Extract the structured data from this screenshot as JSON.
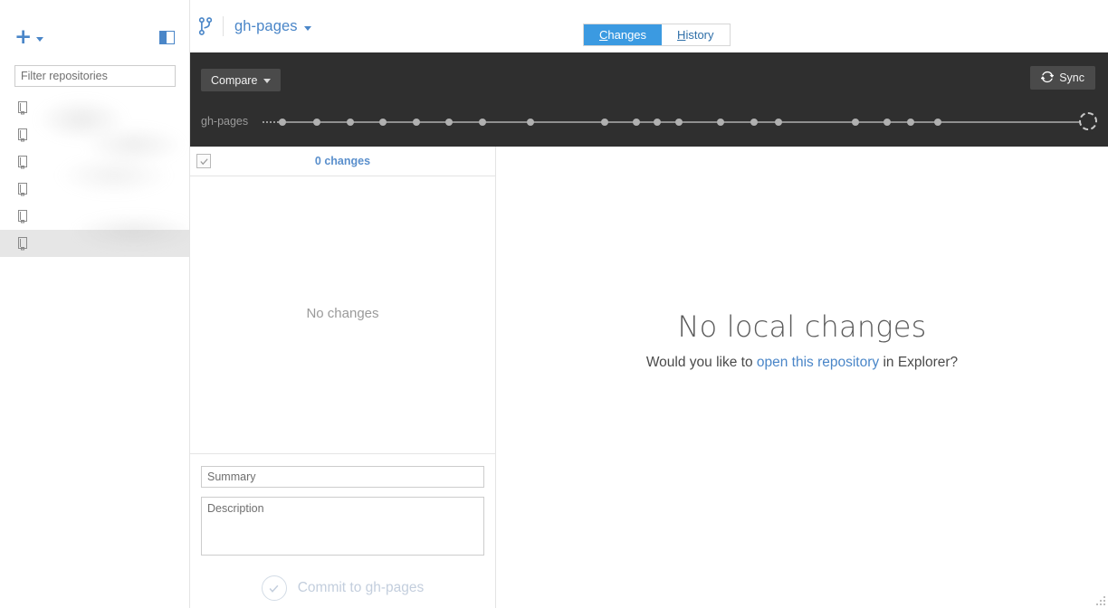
{
  "window": {
    "minimize_label": "—",
    "maximize_label": "□",
    "close_label": "×",
    "settings_icon": "gear-icon"
  },
  "sidebar": {
    "add_repo_label": "+",
    "add_repo_icon": "plus-icon",
    "panel_toggle_icon": "sidebar-toggle-icon",
    "filter": {
      "placeholder": "Filter repositories",
      "value": ""
    },
    "repositories": [
      {
        "name": "",
        "icon": "repo-icon",
        "selected": false
      },
      {
        "name": "",
        "icon": "repo-icon",
        "selected": false
      },
      {
        "name": "",
        "icon": "repo-icon",
        "selected": false
      },
      {
        "name": "",
        "icon": "repo-icon",
        "selected": false
      },
      {
        "name": "",
        "icon": "repo-icon",
        "selected": false
      },
      {
        "name": "",
        "icon": "repo-icon",
        "selected": true
      }
    ]
  },
  "header": {
    "branch_icon": "git-branch-icon",
    "branch_name": "gh-pages",
    "tabs": [
      {
        "accel": "C",
        "rest": "hanges",
        "active": true
      },
      {
        "accel": "H",
        "rest": "istory",
        "active": false
      }
    ]
  },
  "toolbar": {
    "compare_label": "Compare",
    "sync_label": "Sync",
    "sync_icon": "sync-icon",
    "timeline": {
      "branch_label": "gh-pages",
      "dot_positions": [
        22,
        60,
        97,
        133,
        170,
        206,
        243,
        296,
        378,
        413,
        436,
        460,
        506,
        543,
        570,
        655,
        690,
        716,
        746
      ],
      "head_marker": "dashed-circle"
    }
  },
  "changes": {
    "select_all_checked": true,
    "count_label": "0 changes",
    "empty_label": "No changes",
    "summary": {
      "placeholder": "Summary",
      "value": ""
    },
    "description": {
      "placeholder": "Description",
      "value": ""
    },
    "commit_label": "Commit to gh-pages",
    "commit_icon": "check-circle-icon"
  },
  "main": {
    "title": "No local changes",
    "sub_before": "Would you like to ",
    "sub_link": "open this repository",
    "sub_after": " in Explorer?"
  },
  "colors": {
    "accent_blue": "#4a86c8",
    "tab_active": "#3b9ae1",
    "toolbar_dark": "#2f2f2f",
    "button_gray": "#4a4a4a"
  }
}
